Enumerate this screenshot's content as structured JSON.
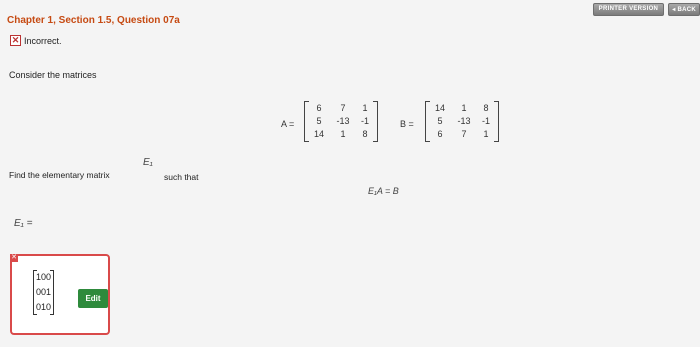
{
  "header": {
    "printer_version_label": "PRINTER VERSION",
    "back_label": "◂ BACK"
  },
  "question": {
    "title": "Chapter 1, Section 1.5, Question 07a",
    "status_mark": "✕",
    "status_text": "Incorrect.",
    "consider_text": "Consider the matrices",
    "find_text": "Find the elementary matrix",
    "e1_symbol": "E₁",
    "such_that_text": "such that",
    "equation_text": "E₁A = B",
    "e1_equals_text": "E₁ ="
  },
  "matrices": {
    "A_label": "A =",
    "A": [
      [
        "6",
        "7",
        "1"
      ],
      [
        "5",
        "-13",
        "-1"
      ],
      [
        "14",
        "1",
        "8"
      ]
    ],
    "B_label": "B =",
    "B": [
      [
        "14",
        "1",
        "8"
      ],
      [
        "5",
        "-13",
        "-1"
      ],
      [
        "6",
        "7",
        "1"
      ]
    ]
  },
  "answer": {
    "rows": [
      "100",
      "001",
      "010"
    ],
    "edit_label": "Edit",
    "corner_mark": "✕"
  },
  "colors": {
    "title": "#c64a12",
    "error": "#d94a4a",
    "edit_button": "#2e8a3c"
  }
}
